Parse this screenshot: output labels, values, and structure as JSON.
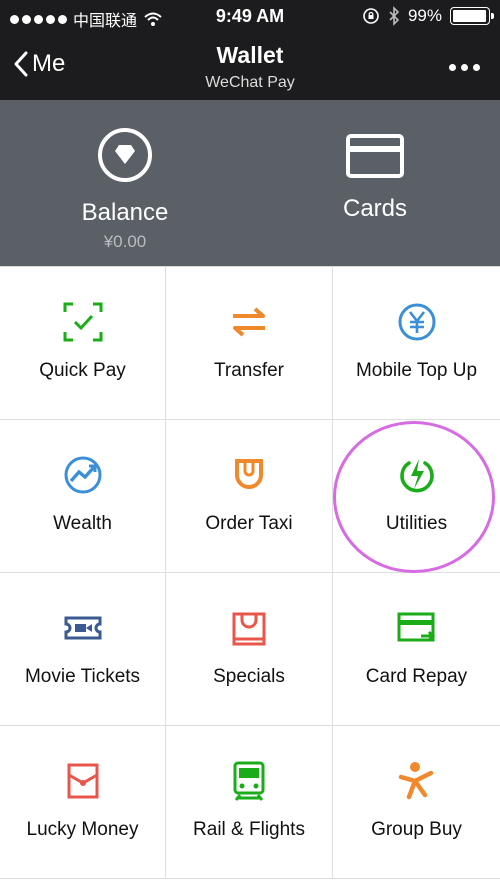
{
  "status_bar": {
    "carrier": "中国联通",
    "time": "9:49 AM",
    "battery": "99%",
    "battery_level": 0.99
  },
  "nav": {
    "back_label": "Me",
    "title": "Wallet",
    "subtitle": "WeChat Pay"
  },
  "top": {
    "balance_label": "Balance",
    "balance_value": "¥0.00",
    "cards_label": "Cards"
  },
  "grid": [
    {
      "label": "Quick Pay",
      "icon": "quick-pay-icon",
      "color": "#1aad19"
    },
    {
      "label": "Transfer",
      "icon": "transfer-icon",
      "color": "#f0892b"
    },
    {
      "label": "Mobile Top Up",
      "icon": "yuan-coin-icon",
      "color": "#3a8fd6"
    },
    {
      "label": "Wealth",
      "icon": "wealth-icon",
      "color": "#3a8fd6"
    },
    {
      "label": "Order Taxi",
      "icon": "taxi-icon",
      "color": "#f0892b"
    },
    {
      "label": "Utilities",
      "icon": "utilities-icon",
      "color": "#1aad19"
    },
    {
      "label": "Movie Tickets",
      "icon": "ticket-icon",
      "color": "#3b5a8f"
    },
    {
      "label": "Specials",
      "icon": "shopping-bag-icon",
      "color": "#e8554b"
    },
    {
      "label": "Card Repay",
      "icon": "card-repay-icon",
      "color": "#1aad19"
    },
    {
      "label": "Lucky Money",
      "icon": "red-envelope-icon",
      "color": "#e8554b"
    },
    {
      "label": "Rail & Flights",
      "icon": "train-icon",
      "color": "#1aad19"
    },
    {
      "label": "Group Buy",
      "icon": "group-buy-icon",
      "color": "#f0892b"
    }
  ],
  "colors": {
    "header_bg": "#1c1c1e",
    "panel_bg": "#5b6067",
    "highlight": "#d66be3"
  }
}
